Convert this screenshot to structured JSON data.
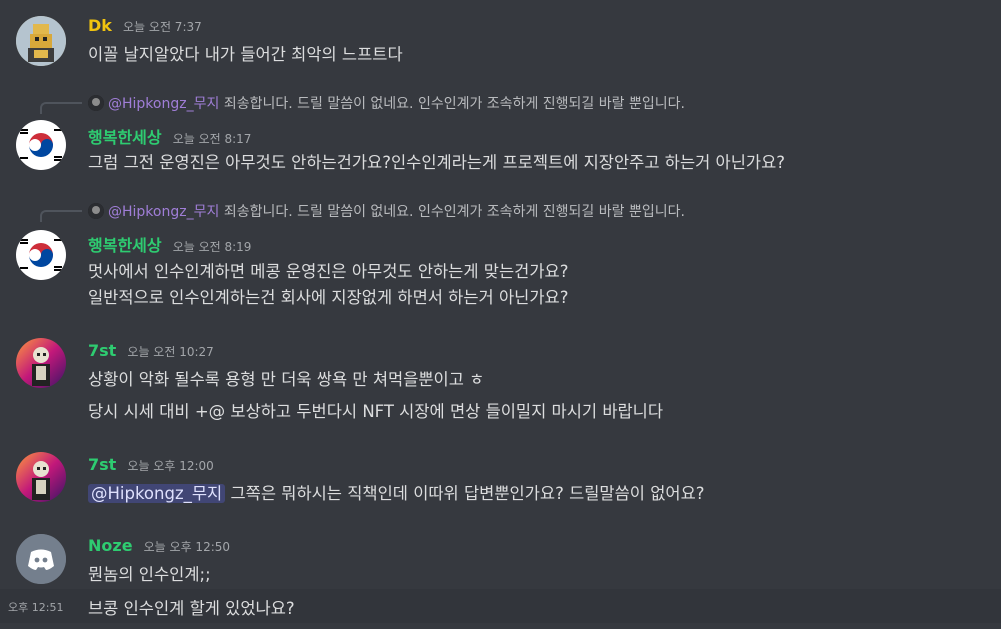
{
  "colors": {
    "background": "#36393f",
    "dk_name": "#f1c40f",
    "green_name": "#2ecc71",
    "mention_bg": "#414675",
    "reply_name": "#a07ed7",
    "discord_blurple": "#5865f2"
  },
  "messages": [
    {
      "author": "Dk",
      "timestamp": "오늘 오전 7:37",
      "avatar": "golden-character-avatar",
      "lines": [
        "이꼴 날지알았다 내가 들어간 최악의 느프트다"
      ]
    },
    {
      "author": "행복한세상",
      "timestamp": "오늘 오전 8:17",
      "avatar": "korean-flag-avatar",
      "reply": {
        "name": "@Hipkongz_무지",
        "text": "죄송합니다. 드릴 말씀이 없네요. 인수인계가 조속하게 진행되길 바랄 뿐입니다."
      },
      "lines": [
        "그럼 그전 운영진은 아무것도 안하는건가요?인수인계라는게 프로젝트에 지장안주고 하는거 아닌가요?"
      ]
    },
    {
      "author": "행복한세상",
      "timestamp": "오늘 오전 8:19",
      "avatar": "korean-flag-avatar",
      "reply": {
        "name": "@Hipkongz_무지",
        "text": "죄송합니다. 드릴 말씀이 없네요. 인수인계가 조속하게 진행되길 바랄 뿐입니다."
      },
      "lines": [
        "멋사에서 인수인계하면 메콩 운영진은 아무것도 안하는게 맞는건가요?",
        "일반적으로 인수인계하는건 회사에 지장없게 하면서 하는거 아닌가요?"
      ]
    },
    {
      "author": "7st",
      "timestamp": "오늘 오전 10:27",
      "avatar": "skeleton-neon-avatar",
      "lines": [
        "상황이 악화 될수록 용형 만 더욱 쌍욕 만 쳐먹을뿐이고 ㅎ",
        "당시 시세 대비 +@ 보상하고 두번다시 NFT 시장에 면상 들이밀지 마시기 바랍니다"
      ]
    },
    {
      "author": "7st",
      "timestamp": "오늘 오후 12:00",
      "avatar": "skeleton-neon-avatar",
      "mention": "@Hipkongz_무지",
      "lines": [
        "그쪽은 뭐하시는 직책인데 이따위 답변뿐인가요? 드릴말씀이 없어요?"
      ]
    },
    {
      "author": "Noze",
      "timestamp": "오늘 오후 12:50",
      "avatar": "discord-default-avatar",
      "lines": [
        "뭔놈의 인수인계;;"
      ]
    }
  ],
  "followup": {
    "hover_time": "오후 12:51",
    "text": "브콩 인수인계 할게 있었나요?"
  }
}
